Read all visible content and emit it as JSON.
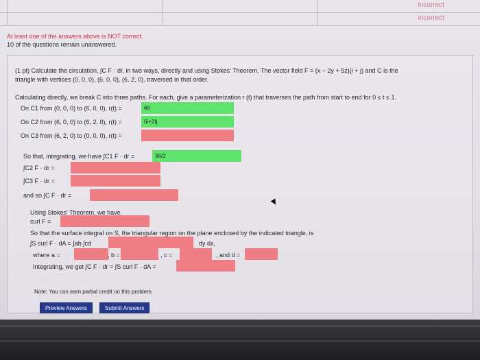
{
  "results": {
    "row1_status": "incorrect",
    "row2_status": "incorrect"
  },
  "warning": {
    "line1": "At least one of the answers above is NOT correct.",
    "line2": "10 of the questions remain unanswered."
  },
  "problem": {
    "intro_line1": "(1 pt) Calculate the circulation, ∫C F · dr, in two ways, directly and using Stokes' Theorem. The vector field F = (x − 2y + 5z)(i + j) and C is the",
    "intro_line2": "triangle with vertices (0, 0, 0), (6, 0, 0), (6, 2, 0), traversed in that order.",
    "directly_line": "Calculating directly, we break C into three paths. For each, give a parameterization r (t) that traverses the path from start to end for 0 ≤ t ≤ 1.",
    "c1_label": "On C1 from (0, 0, 0) to (6, 0, 0), r(t) =",
    "c1_value": "6ti",
    "c2_label": "On C2 from (6, 0, 0) to (6, 2, 0), r(t) =",
    "c2_value": "6i+2tj",
    "c3_label": "On C3 from (6, 2, 0) to (0, 0, 0), r(t) =",
    "c3_value": "",
    "integrating_label": "So that, integrating, we have ∫C1 F · dr =",
    "integrating_value": "36/2",
    "c2_int_label": "∫C2 F · dr =",
    "c3_int_label": "∫C3 F · dr =",
    "andso_label": "and so ∫C F · dr =",
    "stokes_heading": "Using Stokes' Theorem, we have",
    "curl_label": "curl F =",
    "surface_line": "So that the surface integral on S, the triangular region on the plane enclosed by the indicated triangle, is",
    "surface_integral_label": "∫S curl F · dA = ∫ab ∫cd",
    "dydx_label": "dy dx,",
    "where_a_label": "where a =",
    "b_label": ", b =",
    "c_label": ", c =",
    "d_label": ", and d =",
    "final_label": "Integrating, we get ∫C F · dr = ∫S curl F · dA =",
    "note": "Note: You can earn partial credit on this problem."
  },
  "buttons": {
    "preview": "Preview Answers",
    "submit": "Submit Answers"
  },
  "colors": {
    "correct": "#5ee36c",
    "incorrect": "#ee7d84",
    "button": "#263a8c"
  }
}
